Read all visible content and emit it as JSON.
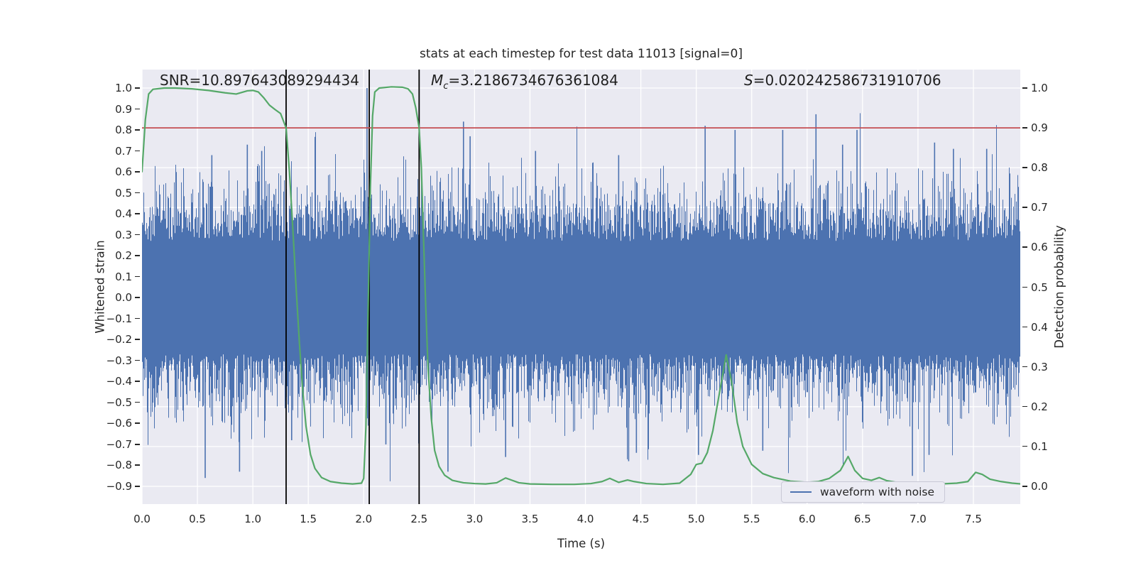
{
  "title": "stats at each timestep for test data 11013 [signal=0]",
  "annotations": {
    "snr": "SNR=10.897643089294434",
    "mc_main": "M",
    "mc_sub": "c",
    "mc_value": "=3.2186734676361084",
    "s_main": "S",
    "s_value": "=0.020242586731910706"
  },
  "legend": {
    "label": "waveform with noise"
  },
  "colors": {
    "waveform": "#4c72b0",
    "detection": "#55a868",
    "threshold": "#c44e52",
    "event_line": "#000000",
    "axes_bg": "#eaeaf2",
    "grid": "#ffffff",
    "text": "#262626"
  },
  "chart_data": {
    "type": "line",
    "title": "stats at each timestep for test data 11013 [signal=0]",
    "xlabel": "Time (s)",
    "ylabel_left": "Whitened strain",
    "ylabel_right": "Detection probability",
    "xlim": [
      0,
      7.93
    ],
    "ylim_left": [
      -0.985,
      1.088
    ],
    "ylim_right": [
      -0.045,
      1.045
    ],
    "grid": true,
    "legend_position": "lower right",
    "x_ticks": [
      {
        "v": 0.0,
        "label": "0.0"
      },
      {
        "v": 0.5,
        "label": "0.5"
      },
      {
        "v": 1.0,
        "label": "1.0"
      },
      {
        "v": 1.5,
        "label": "1.5"
      },
      {
        "v": 2.0,
        "label": "2.0"
      },
      {
        "v": 2.5,
        "label": "2.5"
      },
      {
        "v": 3.0,
        "label": "3.0"
      },
      {
        "v": 3.5,
        "label": "3.5"
      },
      {
        "v": 4.0,
        "label": "4.0"
      },
      {
        "v": 4.5,
        "label": "4.5"
      },
      {
        "v": 5.0,
        "label": "5.0"
      },
      {
        "v": 5.5,
        "label": "5.5"
      },
      {
        "v": 6.0,
        "label": "6.0"
      },
      {
        "v": 6.5,
        "label": "6.5"
      },
      {
        "v": 7.0,
        "label": "7.0"
      },
      {
        "v": 7.5,
        "label": "7.5"
      }
    ],
    "left_ticks": [
      {
        "v": 1.0,
        "label": "1.0"
      },
      {
        "v": 0.9,
        "label": "0.9"
      },
      {
        "v": 0.8,
        "label": "0.8"
      },
      {
        "v": 0.7,
        "label": "0.7"
      },
      {
        "v": 0.6,
        "label": "0.6"
      },
      {
        "v": 0.5,
        "label": "0.5"
      },
      {
        "v": 0.4,
        "label": "0.4"
      },
      {
        "v": 0.3,
        "label": "0.3"
      },
      {
        "v": 0.2,
        "label": "0.2"
      },
      {
        "v": 0.1,
        "label": "0.1"
      },
      {
        "v": 0.0,
        "label": "0.0"
      },
      {
        "v": -0.1,
        "label": "−0.1"
      },
      {
        "v": -0.2,
        "label": "−0.2"
      },
      {
        "v": -0.3,
        "label": "−0.3"
      },
      {
        "v": -0.4,
        "label": "−0.4"
      },
      {
        "v": -0.5,
        "label": "−0.5"
      },
      {
        "v": -0.6,
        "label": "−0.6"
      },
      {
        "v": -0.7,
        "label": "−0.7"
      },
      {
        "v": -0.8,
        "label": "−0.8"
      },
      {
        "v": -0.9,
        "label": "−0.9"
      }
    ],
    "right_ticks": [
      {
        "v": 1.0,
        "label": "1.0"
      },
      {
        "v": 0.9,
        "label": "0.9"
      },
      {
        "v": 0.8,
        "label": "0.8"
      },
      {
        "v": 0.7,
        "label": "0.7"
      },
      {
        "v": 0.6,
        "label": "0.6"
      },
      {
        "v": 0.5,
        "label": "0.5"
      },
      {
        "v": 0.4,
        "label": "0.4"
      },
      {
        "v": 0.3,
        "label": "0.3"
      },
      {
        "v": 0.2,
        "label": "0.2"
      },
      {
        "v": 0.1,
        "label": "0.1"
      },
      {
        "v": 0.0,
        "label": "0.0"
      }
    ],
    "threshold_line": {
      "axis": "right",
      "value": 0.9,
      "color": "#c44e52"
    },
    "event_lines": {
      "times": [
        1.3,
        2.05,
        2.5
      ],
      "color": "#000000"
    },
    "series": [
      {
        "name": "waveform with noise",
        "axis": "left",
        "color": "#4c72b0",
        "style": "dense-noise",
        "t_range": [
          0,
          7.93
        ],
        "core_halfwidth": 0.27,
        "typical_peak": 0.45,
        "max_peak": 0.88,
        "seed": 20,
        "spikes": [
          [
            0.57,
            -0.86
          ],
          [
            0.63,
            0.68
          ],
          [
            0.88,
            -0.83
          ],
          [
            0.95,
            0.73
          ],
          [
            1.08,
            0.7
          ],
          [
            1.35,
            -0.68
          ],
          [
            2.03,
            1.0
          ],
          [
            2.2,
            -0.7
          ],
          [
            2.76,
            -0.83
          ],
          [
            2.9,
            0.84
          ],
          [
            2.96,
            0.77
          ],
          [
            3.28,
            -0.76
          ],
          [
            3.55,
            0.7
          ],
          [
            4.3,
            0.68
          ],
          [
            4.39,
            -0.78
          ],
          [
            4.46,
            -0.74
          ],
          [
            5.02,
            -0.75
          ],
          [
            5.08,
            0.82
          ],
          [
            5.35,
            0.8
          ],
          [
            5.6,
            -0.73
          ],
          [
            5.78,
            0.8
          ],
          [
            6.08,
            0.875
          ],
          [
            6.32,
            0.73
          ],
          [
            6.45,
            0.8
          ],
          [
            6.95,
            -0.85
          ],
          [
            7.1,
            -0.75
          ],
          [
            7.15,
            0.74
          ],
          [
            7.32,
            0.71
          ],
          [
            7.62,
            0.71
          ]
        ]
      },
      {
        "name": "detection probability",
        "axis": "right",
        "color": "#55a868",
        "style": "line",
        "points": [
          [
            0.0,
            0.79
          ],
          [
            0.03,
            0.92
          ],
          [
            0.06,
            0.985
          ],
          [
            0.1,
            0.997
          ],
          [
            0.2,
            1.0
          ],
          [
            0.3,
            1.0
          ],
          [
            0.45,
            0.998
          ],
          [
            0.6,
            0.994
          ],
          [
            0.75,
            0.988
          ],
          [
            0.85,
            0.985
          ],
          [
            0.95,
            0.993
          ],
          [
            1.0,
            0.994
          ],
          [
            1.05,
            0.99
          ],
          [
            1.1,
            0.975
          ],
          [
            1.15,
            0.957
          ],
          [
            1.2,
            0.946
          ],
          [
            1.25,
            0.936
          ],
          [
            1.3,
            0.9
          ],
          [
            1.33,
            0.79
          ],
          [
            1.36,
            0.65
          ],
          [
            1.39,
            0.5
          ],
          [
            1.42,
            0.36
          ],
          [
            1.45,
            0.24
          ],
          [
            1.48,
            0.15
          ],
          [
            1.52,
            0.08
          ],
          [
            1.56,
            0.045
          ],
          [
            1.62,
            0.022
          ],
          [
            1.7,
            0.012
          ],
          [
            1.8,
            0.008
          ],
          [
            1.9,
            0.006
          ],
          [
            1.98,
            0.008
          ],
          [
            2.0,
            0.02
          ],
          [
            2.02,
            0.15
          ],
          [
            2.04,
            0.45
          ],
          [
            2.06,
            0.75
          ],
          [
            2.08,
            0.93
          ],
          [
            2.1,
            0.99
          ],
          [
            2.14,
            1.0
          ],
          [
            2.25,
            1.003
          ],
          [
            2.35,
            1.002
          ],
          [
            2.4,
            0.998
          ],
          [
            2.44,
            0.985
          ],
          [
            2.47,
            0.95
          ],
          [
            2.5,
            0.9
          ],
          [
            2.52,
            0.8
          ],
          [
            2.54,
            0.62
          ],
          [
            2.56,
            0.45
          ],
          [
            2.58,
            0.3
          ],
          [
            2.61,
            0.17
          ],
          [
            2.64,
            0.09
          ],
          [
            2.68,
            0.05
          ],
          [
            2.73,
            0.028
          ],
          [
            2.8,
            0.015
          ],
          [
            2.9,
            0.009
          ],
          [
            3.0,
            0.007
          ],
          [
            3.1,
            0.006
          ],
          [
            3.2,
            0.009
          ],
          [
            3.28,
            0.021
          ],
          [
            3.33,
            0.016
          ],
          [
            3.4,
            0.009
          ],
          [
            3.5,
            0.006
          ],
          [
            3.7,
            0.005
          ],
          [
            3.9,
            0.005
          ],
          [
            4.05,
            0.007
          ],
          [
            4.15,
            0.012
          ],
          [
            4.22,
            0.02
          ],
          [
            4.3,
            0.01
          ],
          [
            4.38,
            0.016
          ],
          [
            4.44,
            0.012
          ],
          [
            4.55,
            0.007
          ],
          [
            4.7,
            0.005
          ],
          [
            4.85,
            0.008
          ],
          [
            4.95,
            0.03
          ],
          [
            5.0,
            0.055
          ],
          [
            5.05,
            0.058
          ],
          [
            5.1,
            0.085
          ],
          [
            5.15,
            0.14
          ],
          [
            5.2,
            0.22
          ],
          [
            5.27,
            0.33
          ],
          [
            5.32,
            0.26
          ],
          [
            5.37,
            0.16
          ],
          [
            5.42,
            0.1
          ],
          [
            5.5,
            0.055
          ],
          [
            5.6,
            0.032
          ],
          [
            5.7,
            0.022
          ],
          [
            5.85,
            0.013
          ],
          [
            6.0,
            0.01
          ],
          [
            6.1,
            0.012
          ],
          [
            6.2,
            0.02
          ],
          [
            6.3,
            0.04
          ],
          [
            6.37,
            0.075
          ],
          [
            6.43,
            0.04
          ],
          [
            6.5,
            0.02
          ],
          [
            6.58,
            0.015
          ],
          [
            6.65,
            0.022
          ],
          [
            6.72,
            0.014
          ],
          [
            6.85,
            0.008
          ],
          [
            7.0,
            0.006
          ],
          [
            7.2,
            0.006
          ],
          [
            7.35,
            0.008
          ],
          [
            7.45,
            0.012
          ],
          [
            7.52,
            0.035
          ],
          [
            7.58,
            0.03
          ],
          [
            7.65,
            0.018
          ],
          [
            7.75,
            0.012
          ],
          [
            7.85,
            0.008
          ],
          [
            7.93,
            0.006
          ]
        ]
      }
    ]
  }
}
